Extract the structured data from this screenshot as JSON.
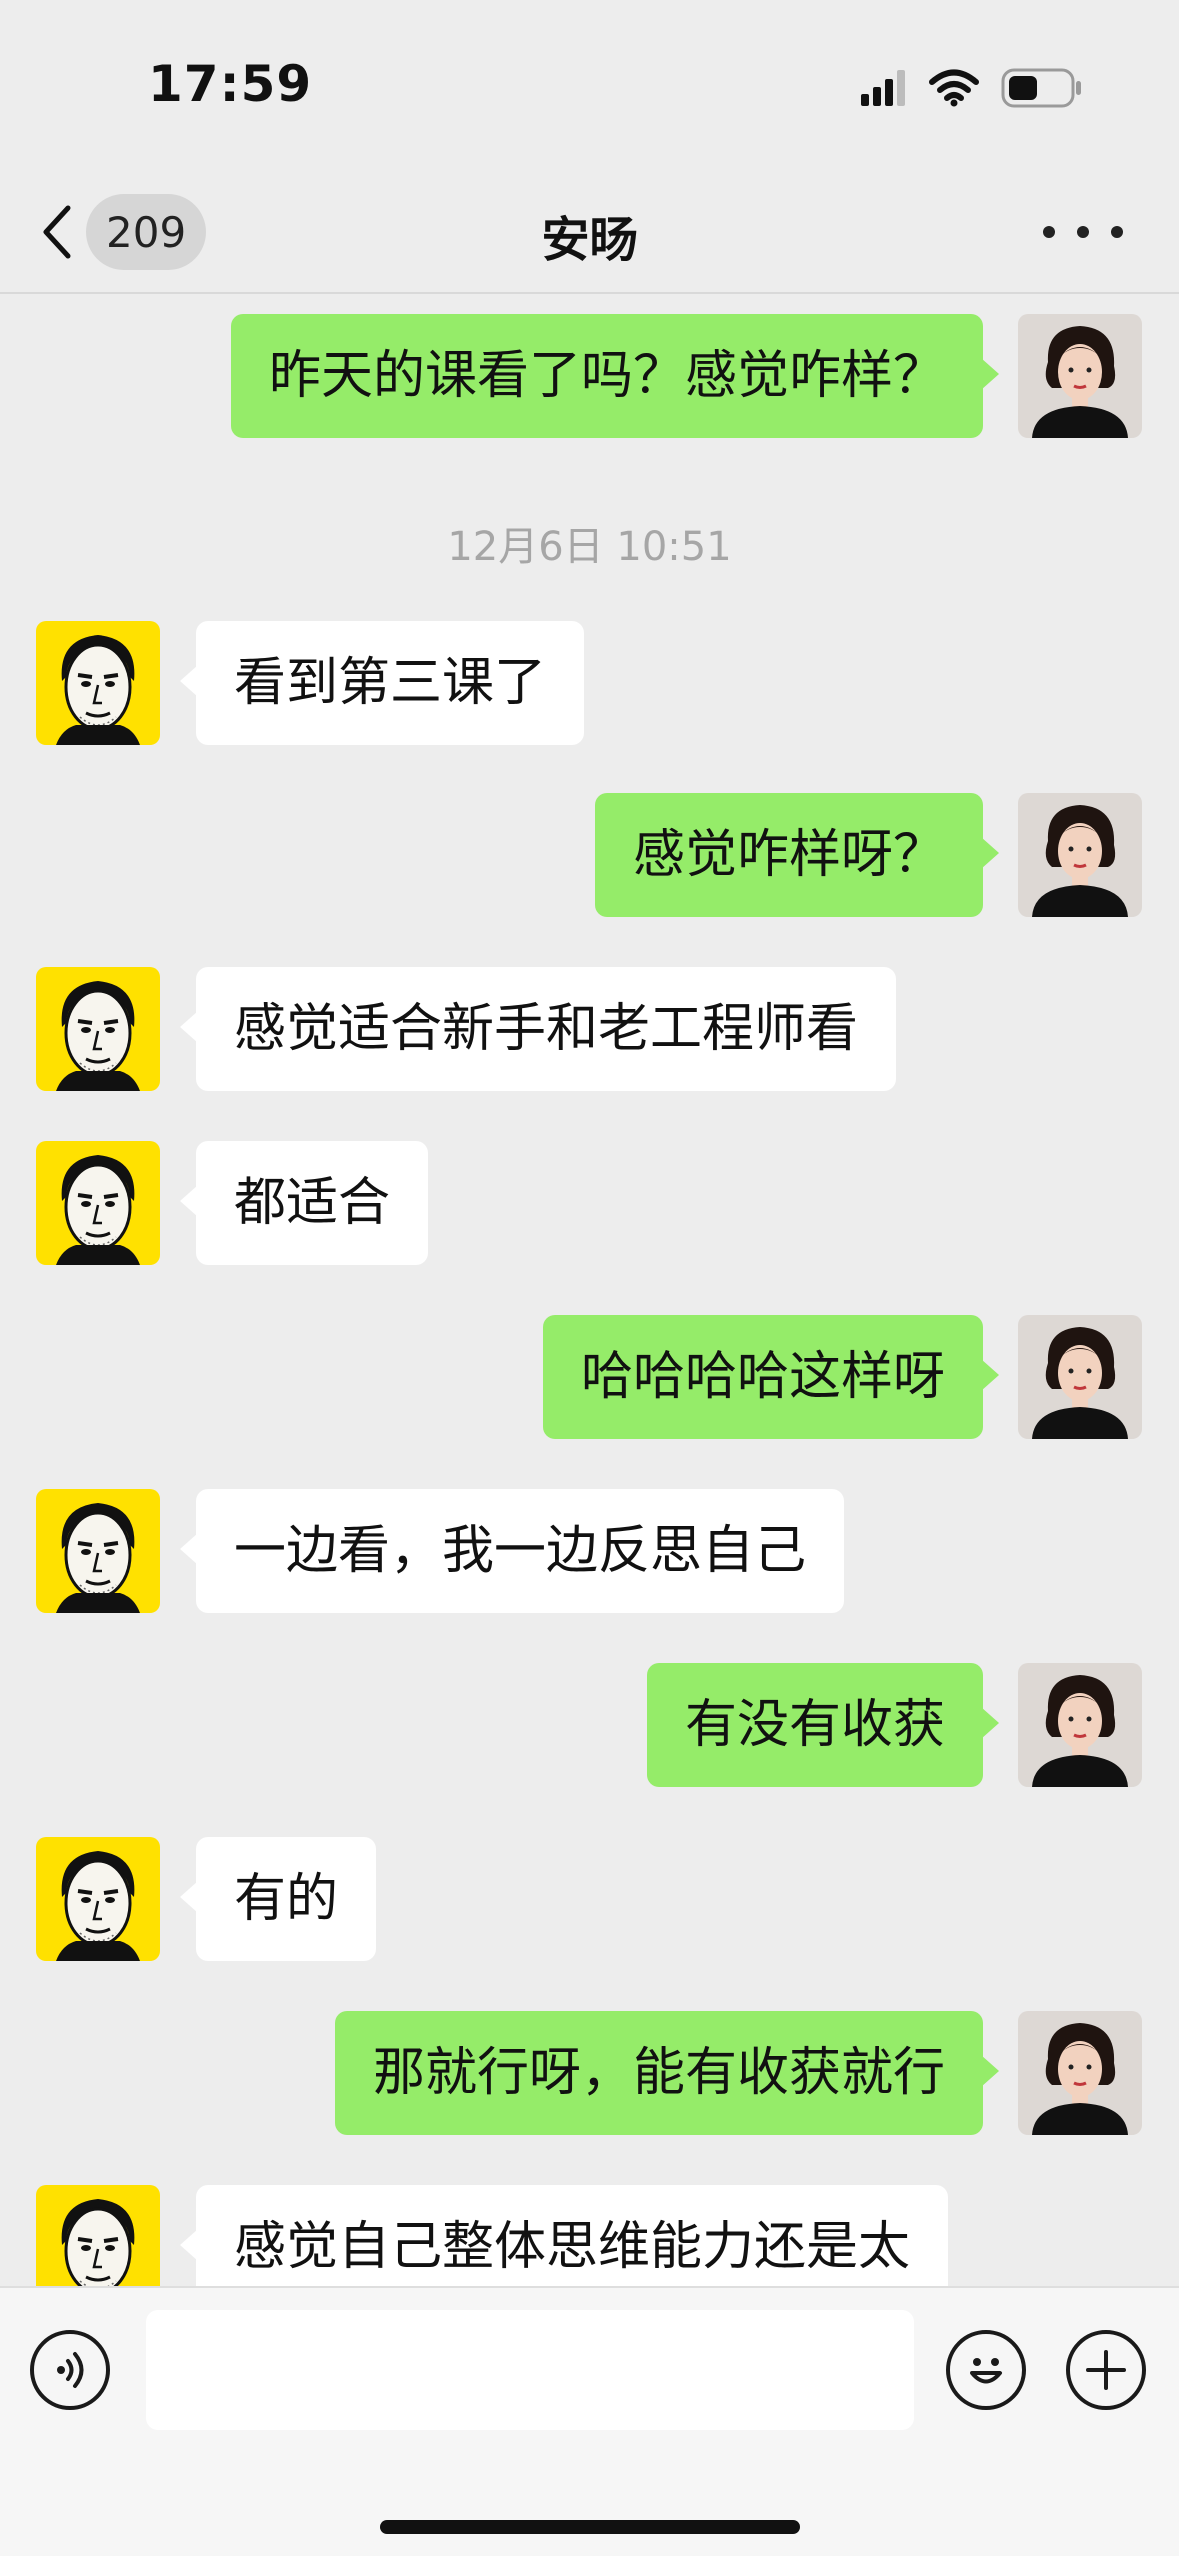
{
  "status_bar": {
    "time": "17:59"
  },
  "nav": {
    "unread_count": "209",
    "title": "安旸"
  },
  "chat": {
    "timestamp": "12月6日 10:51",
    "messages": [
      {
        "side": "right",
        "text": "昨天的课看了吗？感觉咋样？"
      },
      {
        "side": "left",
        "text": "看到第三课了"
      },
      {
        "side": "right",
        "text": "感觉咋样呀？"
      },
      {
        "side": "left",
        "text": "感觉适合新手和老工程师看"
      },
      {
        "side": "left",
        "text": "都适合"
      },
      {
        "side": "right",
        "text": "哈哈哈哈这样呀"
      },
      {
        "side": "left",
        "text": "一边看，我一边反思自己"
      },
      {
        "side": "right",
        "text": "有没有收获"
      },
      {
        "side": "left",
        "text": "有的"
      },
      {
        "side": "right",
        "text": "那就行呀，能有收获就行"
      },
      {
        "side": "left",
        "text": "感觉自己整体思维能力还是太"
      }
    ]
  },
  "input": {
    "value": ""
  },
  "colors": {
    "sent_bubble": "#95ec69",
    "received_bubble": "#ffffff",
    "background": "#ededed",
    "contact_avatar_bg": "#ffe100"
  },
  "icons": {
    "back": "chevron-left-icon",
    "more": "more-dots-icon",
    "voice": "voice-input-icon",
    "emoji": "emoji-icon",
    "plus": "plus-icon",
    "signal": "cellular-signal-icon",
    "wifi": "wifi-icon",
    "battery": "battery-icon"
  }
}
